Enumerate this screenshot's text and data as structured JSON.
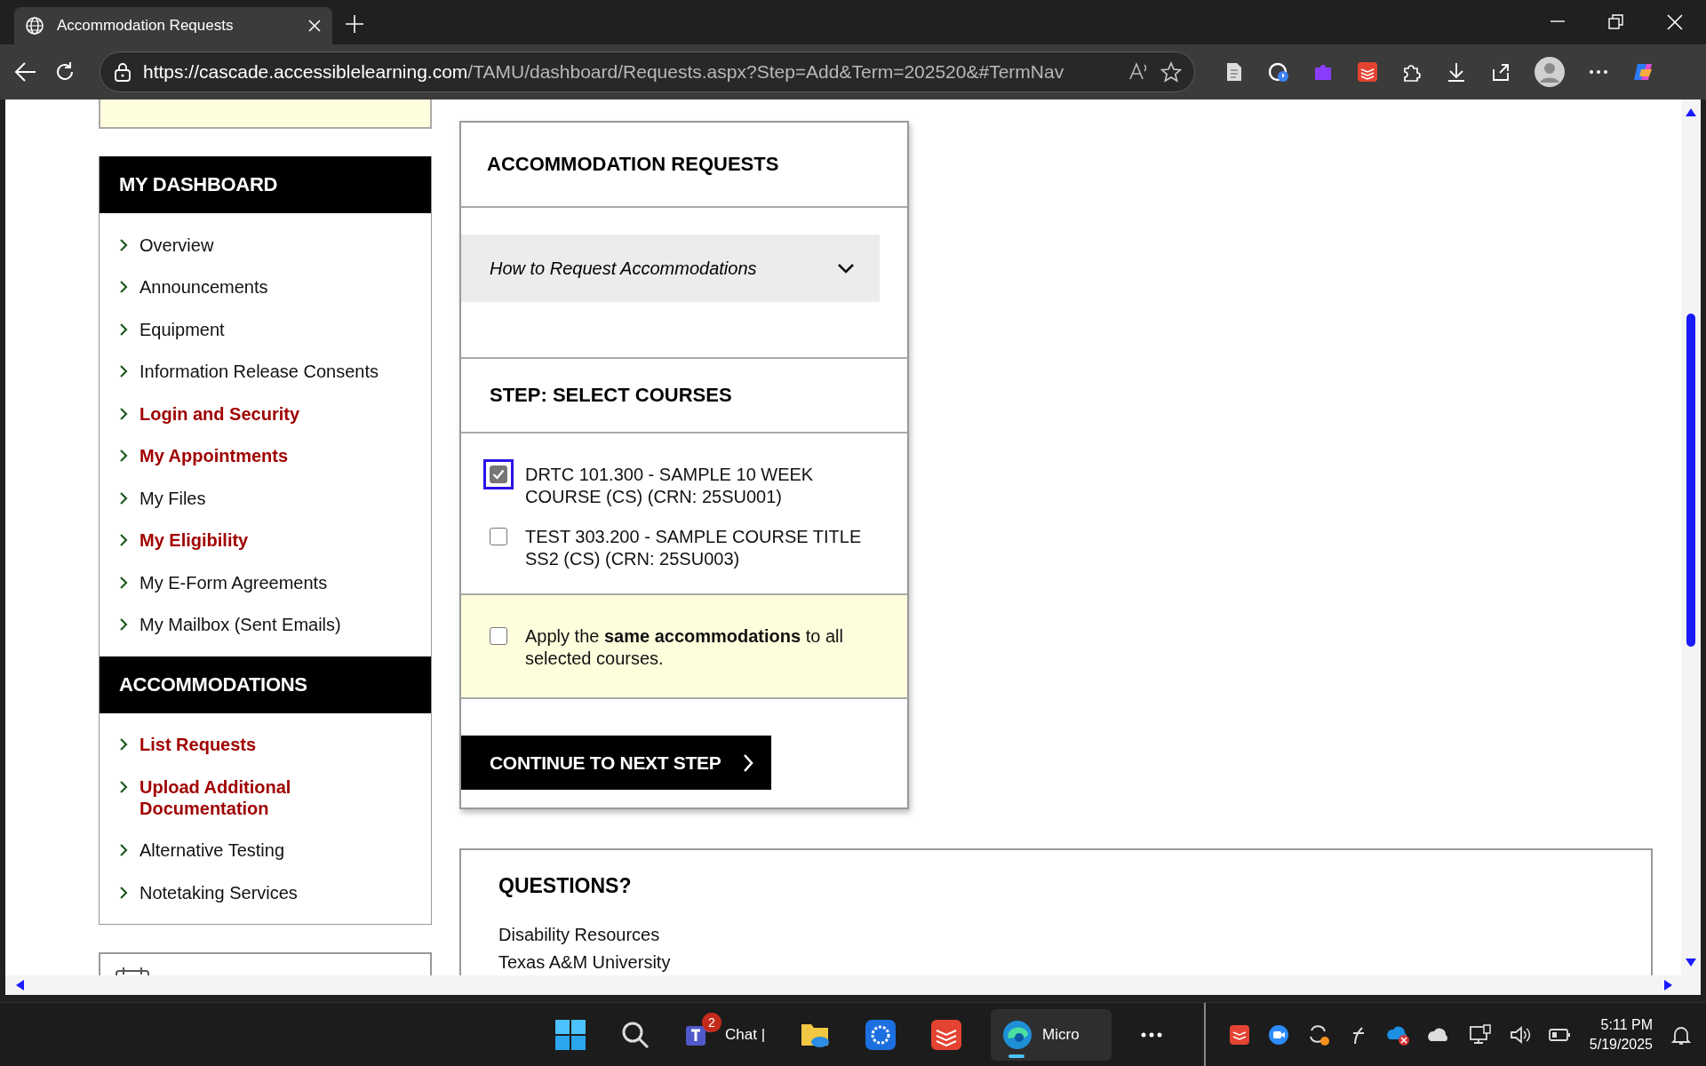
{
  "browser": {
    "tab": {
      "title": "Accommodation Requests",
      "selected": true
    },
    "url_host": "https://cascade.accessiblelearning.com",
    "url_path": "/TAMU/dashboard/Requests.aspx?Step=Add&Term=202520&#TermNav"
  },
  "sidebar": {
    "sections": [
      {
        "title": "MY DASHBOARD",
        "items": [
          {
            "label": "Overview",
            "emphasized": false
          },
          {
            "label": "Announcements",
            "emphasized": false
          },
          {
            "label": "Equipment",
            "emphasized": false
          },
          {
            "label": "Information Release Consents",
            "emphasized": false
          },
          {
            "label": "Login and Security",
            "emphasized": true
          },
          {
            "label": "My Appointments",
            "emphasized": true
          },
          {
            "label": "My Files",
            "emphasized": false
          },
          {
            "label": "My Eligibility",
            "emphasized": true
          },
          {
            "label": "My E-Form Agreements",
            "emphasized": false
          },
          {
            "label": "My Mailbox (Sent Emails)",
            "emphasized": false
          }
        ]
      },
      {
        "title": "ACCOMMODATIONS",
        "items": [
          {
            "label": "List Requests",
            "emphasized": true
          },
          {
            "label": "Upload Additional Documentation",
            "emphasized": true
          },
          {
            "label": "Alternative Testing",
            "emphasized": false
          },
          {
            "label": "Notetaking Services",
            "emphasized": false
          }
        ]
      }
    ]
  },
  "request_panel": {
    "title": "ACCOMMODATION REQUESTS",
    "accordion": {
      "label": "How to Request Accommodations",
      "expanded": false
    },
    "step_title": "STEP: SELECT COURSES",
    "courses": [
      {
        "label": "DRTC 101.300 - SAMPLE 10 WEEK COURSE (CS) (CRN: 25SU001)",
        "checked": true,
        "focused": true
      },
      {
        "label": "TEST 303.200 - SAMPLE COURSE TITLE SS2 (CS) (CRN: 25SU003)",
        "checked": false,
        "focused": false
      }
    ],
    "apply_same": {
      "label": "Apply the **same accommodations** to all selected courses.",
      "checked": false
    },
    "continue_button": "CONTINUE TO NEXT STEP"
  },
  "questions": {
    "title": "QUESTIONS?",
    "lines": [
      "Disability Resources",
      "Texas A&M University"
    ]
  },
  "taskbar": {
    "chat": {
      "label": "Chat |",
      "badge": "2"
    },
    "browser_app": {
      "label": "Micro",
      "selected": true
    },
    "time": "5:11 PM",
    "date": "5/19/2025"
  }
}
